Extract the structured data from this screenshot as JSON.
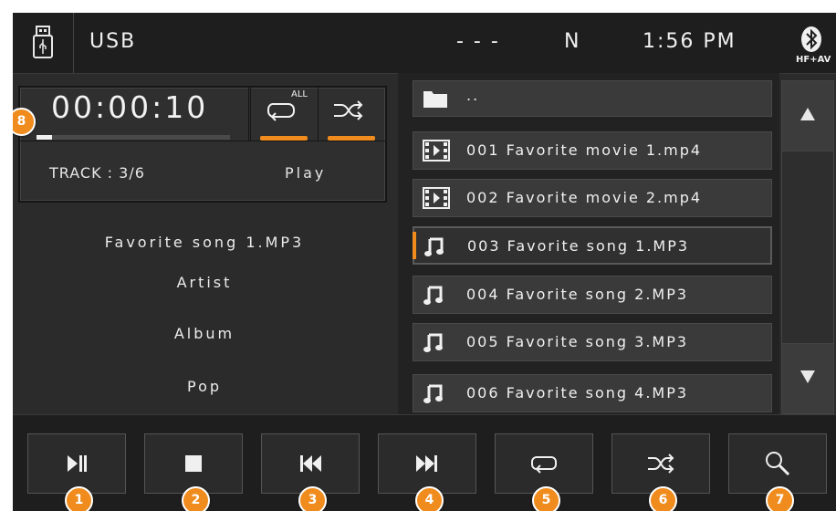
{
  "status": {
    "source": "USB",
    "tuner_info": "- - -",
    "band": "N",
    "clock": "1:56 PM",
    "bluetooth_label": "HF+AV"
  },
  "now_playing": {
    "elapsed": "00:00:10",
    "repeat_badge": "ALL",
    "track": "TRACK : 3/6",
    "state": "Play",
    "progress_fraction": 0.08
  },
  "meta": {
    "title": "Favorite song 1.MP3",
    "artist": "Artist",
    "album": "Album",
    "genre": "Pop"
  },
  "files": [
    {
      "name": "..",
      "icon": "folder-icon"
    },
    {
      "name": "001 Favorite movie 1.mp4",
      "icon": "video-file-icon"
    },
    {
      "name": "002 Favorite movie 2.mp4",
      "icon": "video-file-icon"
    },
    {
      "name": "003 Favorite song 1.MP3",
      "icon": "music-note-icon",
      "selected": true
    },
    {
      "name": "004 Favorite song 2.MP3",
      "icon": "music-note-icon"
    },
    {
      "name": "005 Favorite song 3.MP3",
      "icon": "music-note-icon"
    },
    {
      "name": "006 Favorite song 4.MP3",
      "icon": "music-note-icon"
    }
  ],
  "controls": [
    {
      "id": "play-pause",
      "icon": "play-pause-icon",
      "callout": "1"
    },
    {
      "id": "stop",
      "icon": "stop-icon",
      "callout": "2"
    },
    {
      "id": "previous",
      "icon": "previous-track-icon",
      "callout": "3"
    },
    {
      "id": "next",
      "icon": "next-track-icon",
      "callout": "4"
    },
    {
      "id": "repeat",
      "icon": "repeat-icon",
      "callout": "5"
    },
    {
      "id": "shuffle",
      "icon": "shuffle-icon",
      "callout": "6"
    },
    {
      "id": "search",
      "icon": "search-icon",
      "callout": "7"
    }
  ],
  "callout_progress": "8",
  "colors": {
    "accent": "#f08c1e",
    "background": "#2b2b2b",
    "bar": "#1e1e1e"
  }
}
